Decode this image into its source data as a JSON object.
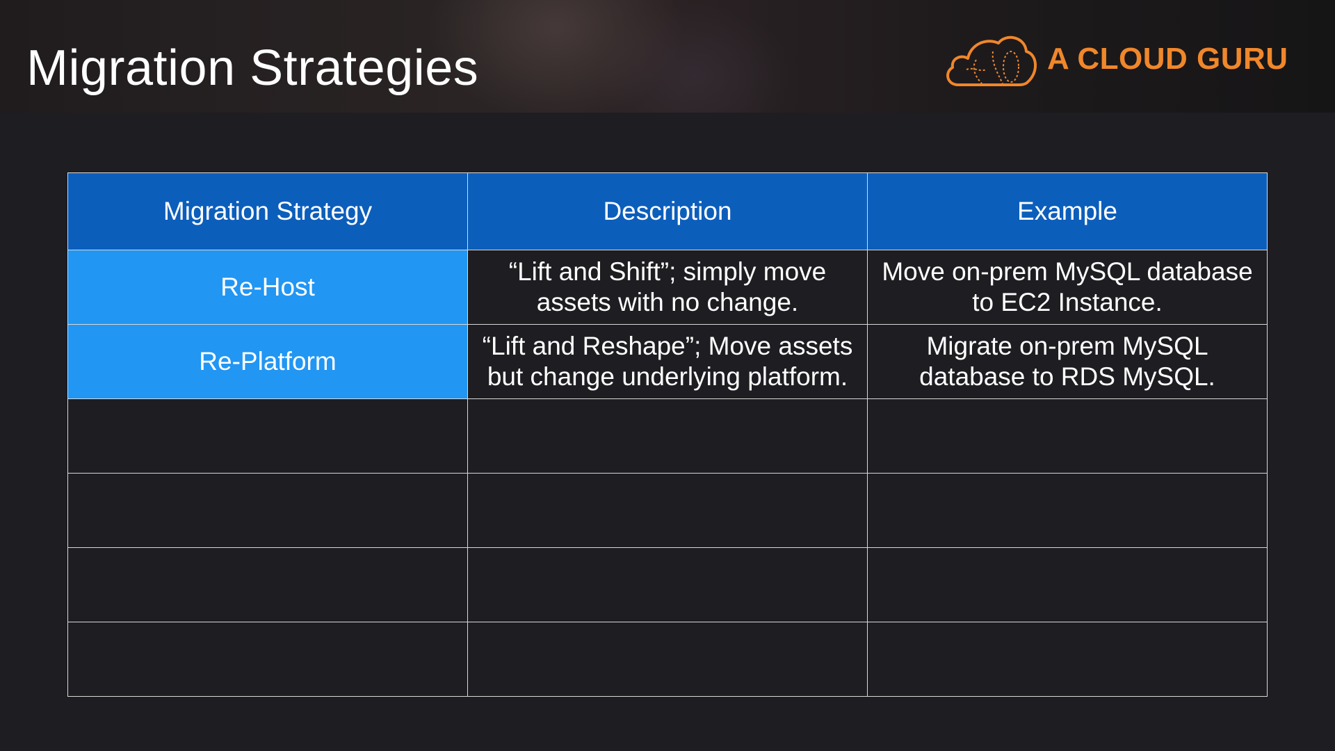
{
  "slide": {
    "title": "Migration Strategies"
  },
  "brand": {
    "name": "A CLOUD GURU",
    "logo_icon": "cloud-logo-icon",
    "color": "#f0872b"
  },
  "colors": {
    "background": "#1e1d21",
    "header_fill": "#0c5ebb",
    "strategy_fill": "#2196f3",
    "grid_line": "#d9d9d9"
  },
  "table": {
    "columns": [
      "Migration Strategy",
      "Description",
      "Example"
    ],
    "rows": [
      [
        "Re-Host",
        "“Lift and Shift”; simply move assets with no change.",
        "Move on-prem MySQL database to EC2 Instance."
      ],
      [
        "Re-Platform",
        "“Lift and Reshape”; Move assets but change underlying platform.",
        "Migrate on-prem MySQL database to RDS MySQL."
      ],
      [
        "",
        "",
        ""
      ],
      [
        "",
        "",
        ""
      ],
      [
        "",
        "",
        ""
      ],
      [
        "",
        "",
        ""
      ]
    ]
  }
}
